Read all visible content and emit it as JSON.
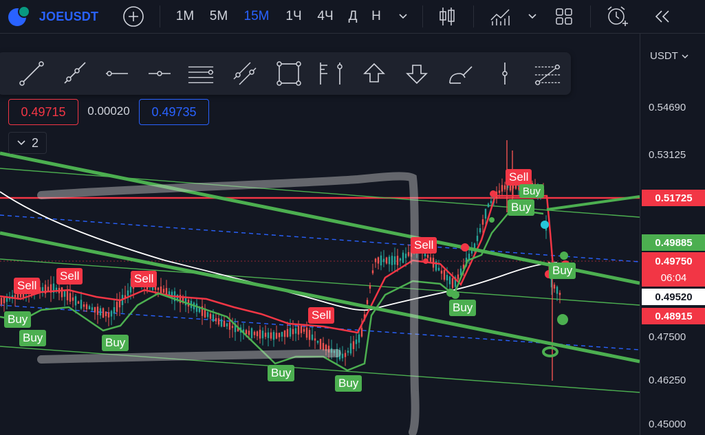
{
  "toolbar": {
    "symbol": "JOEUSDT",
    "intervals": [
      "1M",
      "5M",
      "15M",
      "1Ч",
      "4Ч",
      "Д",
      "Н"
    ],
    "active_interval": "15M"
  },
  "price_boxes": {
    "sell": "0.49715",
    "spread": "0.00020",
    "buy": "0.49735"
  },
  "collapse_count": "2",
  "axis": {
    "currency": "USDT",
    "labels": [
      "0.54690",
      "0.53125",
      "0.47500",
      "0.46250",
      "0.45000"
    ],
    "tags": {
      "red_line": "0.51725",
      "green": "0.49885",
      "current": "0.49750",
      "countdown": "06:04",
      "white": "0.49520",
      "red2": "0.48915"
    }
  },
  "signals": {
    "sell": [
      "Sell",
      "Sell",
      "Sell",
      "Sell",
      "Sell",
      "Sell"
    ],
    "buy": [
      "Buy",
      "Buy",
      "Buy",
      "Buy",
      "Buy",
      "Buy",
      "Buy",
      "Buy",
      "Buy"
    ]
  },
  "colors": {
    "accent": "#2962ff",
    "sell": "#f23645",
    "buy": "#4caf50",
    "bg": "#131722"
  }
}
